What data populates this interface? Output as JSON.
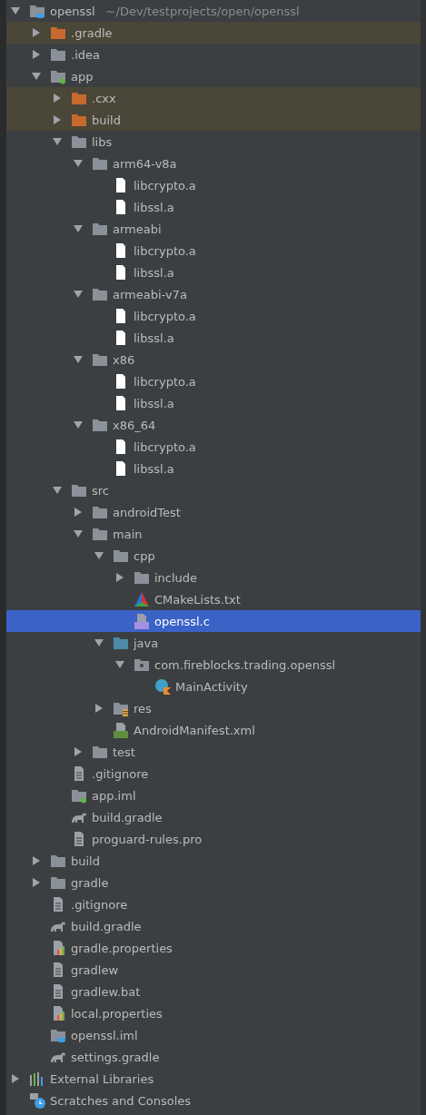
{
  "project_tree": [
    {
      "label": "openssl",
      "path": "~/Dev/testprojects/open/openssl",
      "kind": "project",
      "expanded": true,
      "selected": false,
      "excluded": false,
      "children": [
        {
          "label": ".gradle",
          "kind": "folder",
          "expanded": false,
          "selected": false,
          "excluded": true
        },
        {
          "label": ".idea",
          "kind": "folder",
          "expanded": false,
          "selected": false,
          "excluded": false
        },
        {
          "label": "app",
          "kind": "module",
          "expanded": true,
          "selected": false,
          "excluded": false,
          "children": [
            {
              "label": ".cxx",
              "kind": "folder",
              "expanded": false,
              "selected": false,
              "excluded": true
            },
            {
              "label": "build",
              "kind": "folder",
              "expanded": false,
              "selected": false,
              "excluded": true
            },
            {
              "label": "libs",
              "kind": "folder",
              "expanded": true,
              "selected": false,
              "excluded": false,
              "children": [
                {
                  "label": "arm64-v8a",
                  "kind": "folder",
                  "expanded": true,
                  "selected": false,
                  "excluded": false,
                  "children": [
                    {
                      "label": "libcrypto.a",
                      "kind": "file",
                      "selected": false,
                      "excluded": false
                    },
                    {
                      "label": "libssl.a",
                      "kind": "file",
                      "selected": false,
                      "excluded": false
                    }
                  ]
                },
                {
                  "label": "armeabi",
                  "kind": "folder",
                  "expanded": true,
                  "selected": false,
                  "excluded": false,
                  "children": [
                    {
                      "label": "libcrypto.a",
                      "kind": "file",
                      "selected": false,
                      "excluded": false
                    },
                    {
                      "label": "libssl.a",
                      "kind": "file",
                      "selected": false,
                      "excluded": false
                    }
                  ]
                },
                {
                  "label": "armeabi-v7a",
                  "kind": "folder",
                  "expanded": true,
                  "selected": false,
                  "excluded": false,
                  "children": [
                    {
                      "label": "libcrypto.a",
                      "kind": "file",
                      "selected": false,
                      "excluded": false
                    },
                    {
                      "label": "libssl.a",
                      "kind": "file",
                      "selected": false,
                      "excluded": false
                    }
                  ]
                },
                {
                  "label": "x86",
                  "kind": "folder",
                  "expanded": true,
                  "selected": false,
                  "excluded": false,
                  "children": [
                    {
                      "label": "libcrypto.a",
                      "kind": "file",
                      "selected": false,
                      "excluded": false
                    },
                    {
                      "label": "libssl.a",
                      "kind": "file",
                      "selected": false,
                      "excluded": false
                    }
                  ]
                },
                {
                  "label": "x86_64",
                  "kind": "folder",
                  "expanded": true,
                  "selected": false,
                  "excluded": false,
                  "children": [
                    {
                      "label": "libcrypto.a",
                      "kind": "file",
                      "selected": false,
                      "excluded": false
                    },
                    {
                      "label": "libssl.a",
                      "kind": "file",
                      "selected": false,
                      "excluded": false
                    }
                  ]
                }
              ]
            },
            {
              "label": "src",
              "kind": "folder",
              "expanded": true,
              "selected": false,
              "excluded": false,
              "children": [
                {
                  "label": "androidTest",
                  "kind": "folder",
                  "expanded": false,
                  "selected": false,
                  "excluded": false
                },
                {
                  "label": "main",
                  "kind": "folder",
                  "expanded": true,
                  "selected": false,
                  "excluded": false,
                  "children": [
                    {
                      "label": "cpp",
                      "kind": "folder",
                      "expanded": true,
                      "selected": false,
                      "excluded": false,
                      "children": [
                        {
                          "label": "include",
                          "kind": "folder",
                          "expanded": false,
                          "selected": false,
                          "excluded": false
                        },
                        {
                          "label": "CMakeLists.txt",
                          "kind": "cmake",
                          "selected": false,
                          "excluded": false
                        },
                        {
                          "label": "openssl.c",
                          "kind": "cfile",
                          "selected": true,
                          "excluded": false
                        }
                      ]
                    },
                    {
                      "label": "java",
                      "kind": "source",
                      "expanded": true,
                      "selected": false,
                      "excluded": false,
                      "children": [
                        {
                          "label": "com.fireblocks.trading.openssl",
                          "kind": "package",
                          "expanded": true,
                          "selected": false,
                          "excluded": false,
                          "children": [
                            {
                              "label": "MainActivity",
                              "kind": "kotlin",
                              "selected": false,
                              "excluded": false
                            }
                          ]
                        }
                      ]
                    },
                    {
                      "label": "res",
                      "kind": "res",
                      "expanded": false,
                      "selected": false,
                      "excluded": false
                    },
                    {
                      "label": "AndroidManifest.xml",
                      "kind": "manifest",
                      "selected": false,
                      "excluded": false
                    }
                  ]
                },
                {
                  "label": "test",
                  "kind": "folder",
                  "expanded": false,
                  "selected": false,
                  "excluded": false
                }
              ]
            },
            {
              "label": ".gitignore",
              "kind": "text",
              "selected": false,
              "excluded": false
            },
            {
              "label": "app.iml",
              "kind": "moduleiml",
              "selected": false,
              "excluded": false
            },
            {
              "label": "build.gradle",
              "kind": "gradle",
              "selected": false,
              "excluded": false
            },
            {
              "label": "proguard-rules.pro",
              "kind": "text",
              "selected": false,
              "excluded": false
            }
          ]
        },
        {
          "label": "build",
          "kind": "folder",
          "expanded": false,
          "selected": false,
          "excluded": false
        },
        {
          "label": "gradle",
          "kind": "folder",
          "expanded": false,
          "selected": false,
          "excluded": false
        },
        {
          "label": ".gitignore",
          "kind": "text",
          "selected": false,
          "excluded": false
        },
        {
          "label": "build.gradle",
          "kind": "gradle",
          "selected": false,
          "excluded": false
        },
        {
          "label": "gradle.properties",
          "kind": "properties",
          "selected": false,
          "excluded": false
        },
        {
          "label": "gradlew",
          "kind": "text",
          "selected": false,
          "excluded": false
        },
        {
          "label": "gradlew.bat",
          "kind": "text",
          "selected": false,
          "excluded": false
        },
        {
          "label": "local.properties",
          "kind": "properties",
          "selected": false,
          "excluded": false
        },
        {
          "label": "openssl.iml",
          "kind": "projectiml",
          "selected": false,
          "excluded": false
        },
        {
          "label": "settings.gradle",
          "kind": "gradle",
          "selected": false,
          "excluded": false
        }
      ]
    },
    {
      "label": "External Libraries",
      "kind": "libraries",
      "expanded": false,
      "selected": false,
      "excluded": false
    },
    {
      "label": "Scratches and Consoles",
      "kind": "scratches",
      "selected": false,
      "excluded": false
    }
  ]
}
